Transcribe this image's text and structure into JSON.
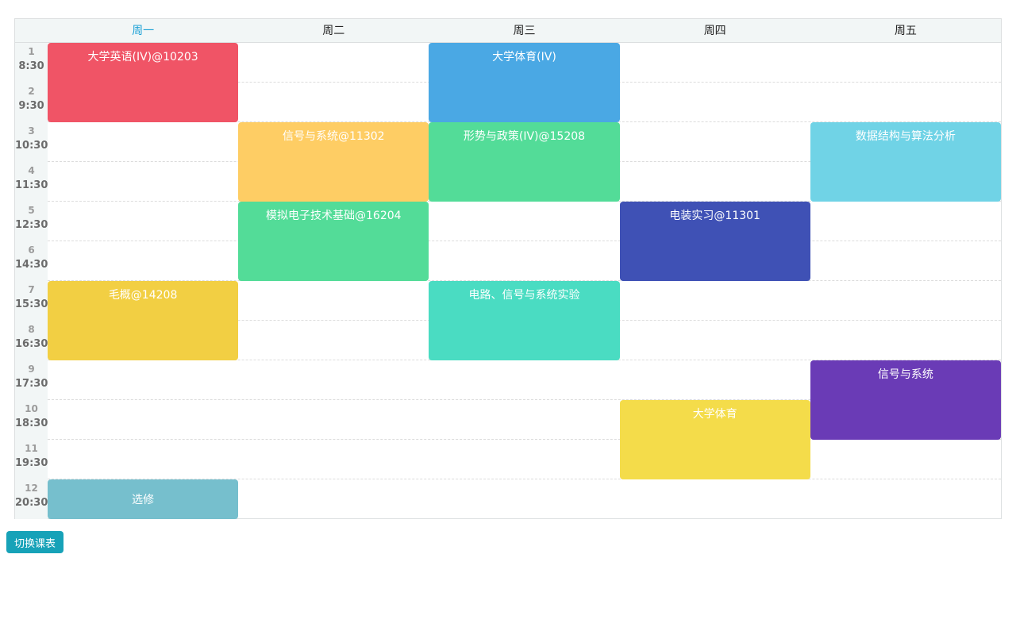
{
  "days": [
    "周一",
    "周二",
    "周三",
    "周四",
    "周五"
  ],
  "active_day": "周一",
  "periods": [
    {
      "num": "1",
      "time": "8:30"
    },
    {
      "num": "2",
      "time": "9:30"
    },
    {
      "num": "3",
      "time": "10:30"
    },
    {
      "num": "4",
      "time": "11:30"
    },
    {
      "num": "5",
      "time": "12:30"
    },
    {
      "num": "6",
      "time": "14:30"
    },
    {
      "num": "7",
      "time": "15:30"
    },
    {
      "num": "8",
      "time": "16:30"
    },
    {
      "num": "9",
      "time": "17:30"
    },
    {
      "num": "10",
      "time": "18:30"
    },
    {
      "num": "11",
      "time": "19:30"
    },
    {
      "num": "12",
      "time": "20:30"
    }
  ],
  "courses": [
    {
      "name": "大学英语(IV)@10203",
      "day": 1,
      "start": 1,
      "span": 2,
      "color": "#f05466"
    },
    {
      "name": "大学体育(IV)",
      "day": 3,
      "start": 1,
      "span": 2,
      "color": "#4aa8e4"
    },
    {
      "name": "信号与系统@11302",
      "day": 2,
      "start": 3,
      "span": 2,
      "color": "#fecd64"
    },
    {
      "name": "形势与政策(IV)@15208",
      "day": 3,
      "start": 3,
      "span": 2,
      "color": "#53dc98"
    },
    {
      "name": "数据结构与算法分析",
      "day": 5,
      "start": 3,
      "span": 2,
      "color": "#70d3e6"
    },
    {
      "name": "模拟电子技术基础@16204",
      "day": 2,
      "start": 5,
      "span": 2,
      "color": "#53dc98"
    },
    {
      "name": "电装实习@11301",
      "day": 4,
      "start": 5,
      "span": 2,
      "color": "#3f51b5"
    },
    {
      "name": "毛概@14208",
      "day": 1,
      "start": 7,
      "span": 2,
      "color": "#f2cf43"
    },
    {
      "name": "电路、信号与系统实验",
      "day": 3,
      "start": 7,
      "span": 2,
      "color": "#4adcc2"
    },
    {
      "name": "信号与系统",
      "day": 5,
      "start": 9,
      "span": 2,
      "color": "#6a3bb6"
    },
    {
      "name": "大学体育",
      "day": 4,
      "start": 10,
      "span": 2,
      "color": "#f4dc4a"
    },
    {
      "name": "选修",
      "day": 1,
      "start": 12,
      "span": 1,
      "color": "#76bfcd",
      "center": true
    }
  ],
  "switch_button_label": "切换课表"
}
